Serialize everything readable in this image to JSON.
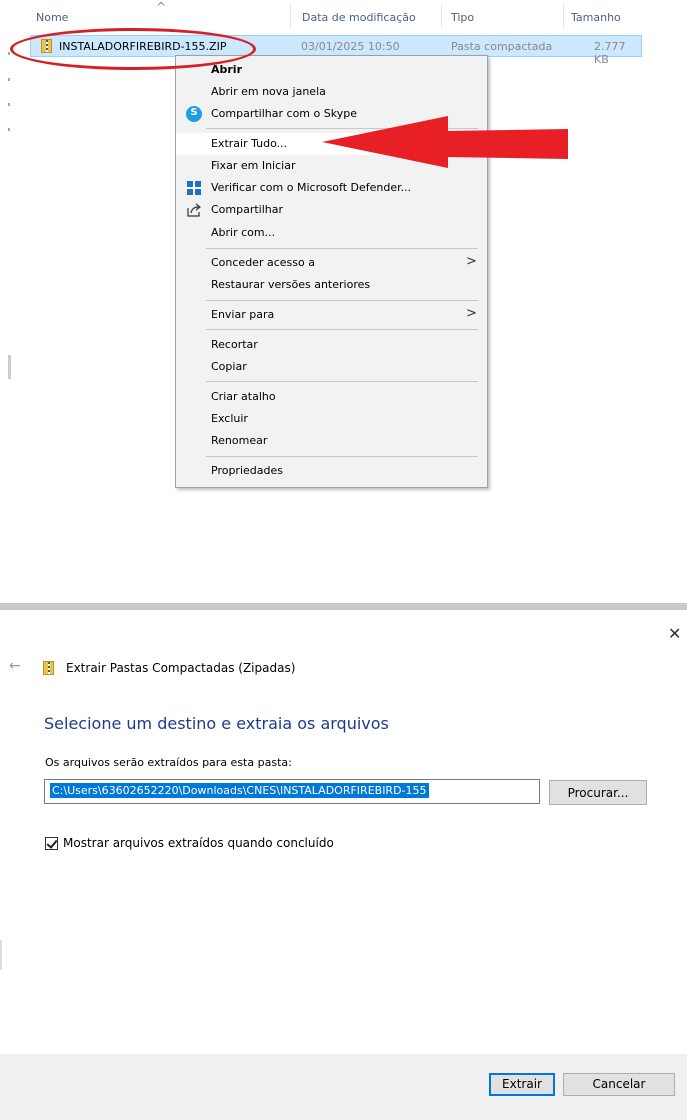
{
  "explorer": {
    "columns": [
      "Nome",
      "Data de modificação",
      "Tipo",
      "Tamanho"
    ],
    "file": {
      "name": "INSTALADORFIREBIRD-155.ZIP",
      "modified": "03/01/2025 10:50",
      "type": "Pasta compactada",
      "size": "2.777 KB",
      "icon": "zip-folder-icon"
    },
    "highlight_color": "#d42027"
  },
  "context_menu": {
    "items": [
      {
        "label": "Abrir"
      },
      {
        "label": "Abrir em nova janela"
      },
      {
        "label": "Compartilhar com o Skype",
        "icon": "skype-icon"
      },
      {
        "label": "Extrair Tudo..."
      },
      {
        "label": "Fixar em Iniciar"
      },
      {
        "label": "Verificar com o Microsoft Defender...",
        "icon": "defender-icon"
      },
      {
        "label": "Compartilhar",
        "icon": "share-icon"
      },
      {
        "label": "Abrir com..."
      },
      {
        "label": "Conceder acesso a"
      },
      {
        "label": "Restaurar versões anteriores"
      },
      {
        "label": "Enviar para"
      },
      {
        "label": "Recortar"
      },
      {
        "label": "Copiar"
      },
      {
        "label": "Criar atalho"
      },
      {
        "label": "Excluir"
      },
      {
        "label": "Renomear"
      },
      {
        "label": "Propriedades"
      }
    ]
  },
  "dialog": {
    "title": "Extrair Pastas Compactadas (Zipadas)",
    "heading": "Selecione um destino e extraia os arquivos",
    "subtitle": "Os arquivos serão extraídos para esta pasta:",
    "path": "C:\\Users\\63602652220\\Downloads\\CNES\\INSTALADORFIREBIRD-155",
    "browse_label": "Procurar...",
    "checkbox_label": "Mostrar arquivos extraídos quando concluído",
    "checkbox_checked": true,
    "extract_label": "Extrair",
    "cancel_label": "Cancelar",
    "accent": "#0078d7"
  }
}
